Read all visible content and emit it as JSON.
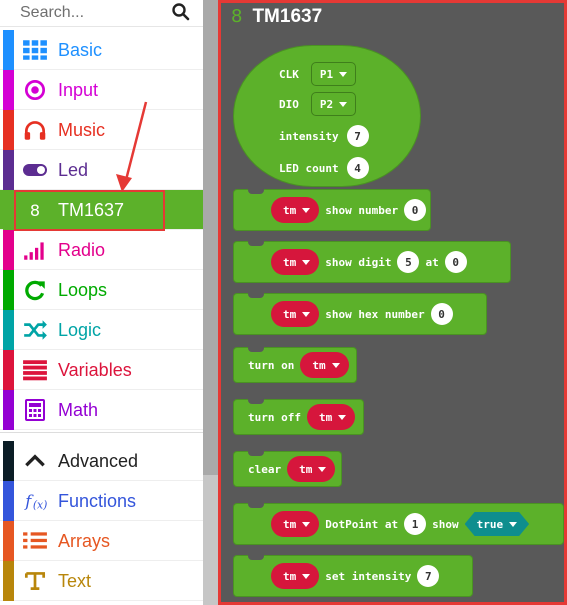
{
  "search": {
    "placeholder": "Search..."
  },
  "categories": [
    {
      "label": "Basic",
      "color": "#1e90ff",
      "icon": "grid-icon"
    },
    {
      "label": "Input",
      "color": "#d400d4",
      "icon": "target-icon"
    },
    {
      "label": "Music",
      "color": "#e63022",
      "icon": "headphones-icon"
    },
    {
      "label": "Led",
      "color": "#5c2d91",
      "icon": "toggle-icon"
    },
    {
      "label": "TM1637",
      "color": "#5cb12a",
      "icon": "8"
    },
    {
      "label": "Radio",
      "color": "#e3008c",
      "icon": "signal-bars-icon"
    },
    {
      "label": "Loops",
      "color": "#00aa00",
      "icon": "refresh-icon"
    },
    {
      "label": "Logic",
      "color": "#00a4a6",
      "icon": "shuffle-icon"
    },
    {
      "label": "Variables",
      "color": "#dc143c",
      "icon": "list-icon"
    },
    {
      "label": "Math",
      "color": "#9400d3",
      "icon": "calculator-icon"
    },
    {
      "label": "Advanced",
      "color": "#333333",
      "icon": "chevron-up-icon"
    },
    {
      "label": "Functions",
      "color": "#3455db",
      "icon": "function-icon"
    },
    {
      "label": "Arrays",
      "color": "#e65722",
      "icon": "numbered-list-icon"
    },
    {
      "label": "Text",
      "color": "#b8860b",
      "icon": "text-icon"
    }
  ],
  "flyout": {
    "number_glyph": "8",
    "title": "TM1637",
    "init": {
      "clk_label": "CLK",
      "clk_value": "P1",
      "dio_label": "DIO",
      "dio_value": "P2",
      "intensity_label": "intensity",
      "intensity_value": "7",
      "led_count_label": "LED count",
      "led_count_value": "4"
    },
    "blocks": {
      "show_number": {
        "var": "tm",
        "text": "show number",
        "value": "0"
      },
      "show_digit": {
        "var": "tm",
        "text": "show digit",
        "value": "5",
        "at": "at",
        "at_value": "0"
      },
      "show_hex": {
        "var": "tm",
        "text": "show hex number",
        "value": "0"
      },
      "turn_on": {
        "text": "turn on",
        "var": "tm"
      },
      "turn_off": {
        "text": "turn off",
        "var": "tm"
      },
      "clear": {
        "text": "clear",
        "var": "tm"
      },
      "dotpoint": {
        "var": "tm",
        "text": "DotPoint at",
        "value": "1",
        "show": "show",
        "show_value": "true"
      },
      "set_intensity": {
        "var": "tm",
        "text": "set intensity",
        "value": "7"
      }
    }
  }
}
